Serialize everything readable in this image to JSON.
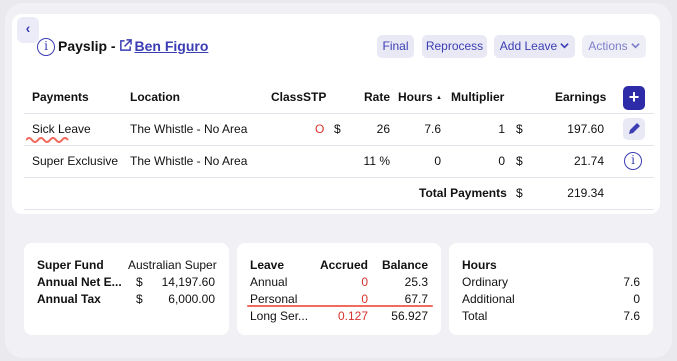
{
  "header": {
    "title_prefix": "Payslip -",
    "employee_name": "Ben Figuro",
    "buttons": {
      "final": "Final",
      "reprocess": "Reprocess",
      "add_leave": "Add Leave",
      "actions": "Actions"
    }
  },
  "table": {
    "headers": {
      "payments": "Payments",
      "location": "Location",
      "class": "Class",
      "stp": "STP",
      "rate": "Rate",
      "hours": "Hours",
      "multiplier": "Multiplier",
      "earnings": "Earnings"
    },
    "rows": [
      {
        "payment": "Sick Leave",
        "location": "The Whistle - No Area",
        "stp": "O",
        "currency": "$",
        "rate": "26",
        "hours": "7.6",
        "multiplier": "1",
        "earn_currency": "$",
        "earnings": "197.60"
      },
      {
        "payment": "Super Exclusive",
        "location": "The Whistle - No Area",
        "rate": "11 %",
        "hours": "0",
        "multiplier": "0",
        "earn_currency": "$",
        "earnings": "21.74"
      }
    ],
    "total_label": "Total Payments",
    "total_currency": "$",
    "total_value": "219.34"
  },
  "super_panel": {
    "fund_label": "Super Fund",
    "fund_value": "Australian Super",
    "net_label": "Annual Net E...",
    "net_currency": "$",
    "net_value": "14,197.60",
    "tax_label": "Annual Tax",
    "tax_currency": "$",
    "tax_value": "6,000.00"
  },
  "leave_panel": {
    "headers": {
      "leave": "Leave",
      "accrued": "Accrued",
      "balance": "Balance"
    },
    "rows": [
      {
        "name": "Annual",
        "accrued": "0",
        "balance": "25.3"
      },
      {
        "name": "Personal",
        "accrued": "0",
        "balance": "67.7"
      },
      {
        "name": "Long Ser...",
        "accrued": "0.127",
        "balance": "56.927"
      }
    ]
  },
  "hours_panel": {
    "title": "Hours",
    "rows": [
      {
        "name": "Ordinary",
        "value": "7.6"
      },
      {
        "name": "Additional",
        "value": "0"
      },
      {
        "name": "Total",
        "value": "7.6"
      }
    ]
  },
  "colors": {
    "accent": "#2d2ba8",
    "link": "#3b3db3",
    "alert": "#d8322c"
  }
}
